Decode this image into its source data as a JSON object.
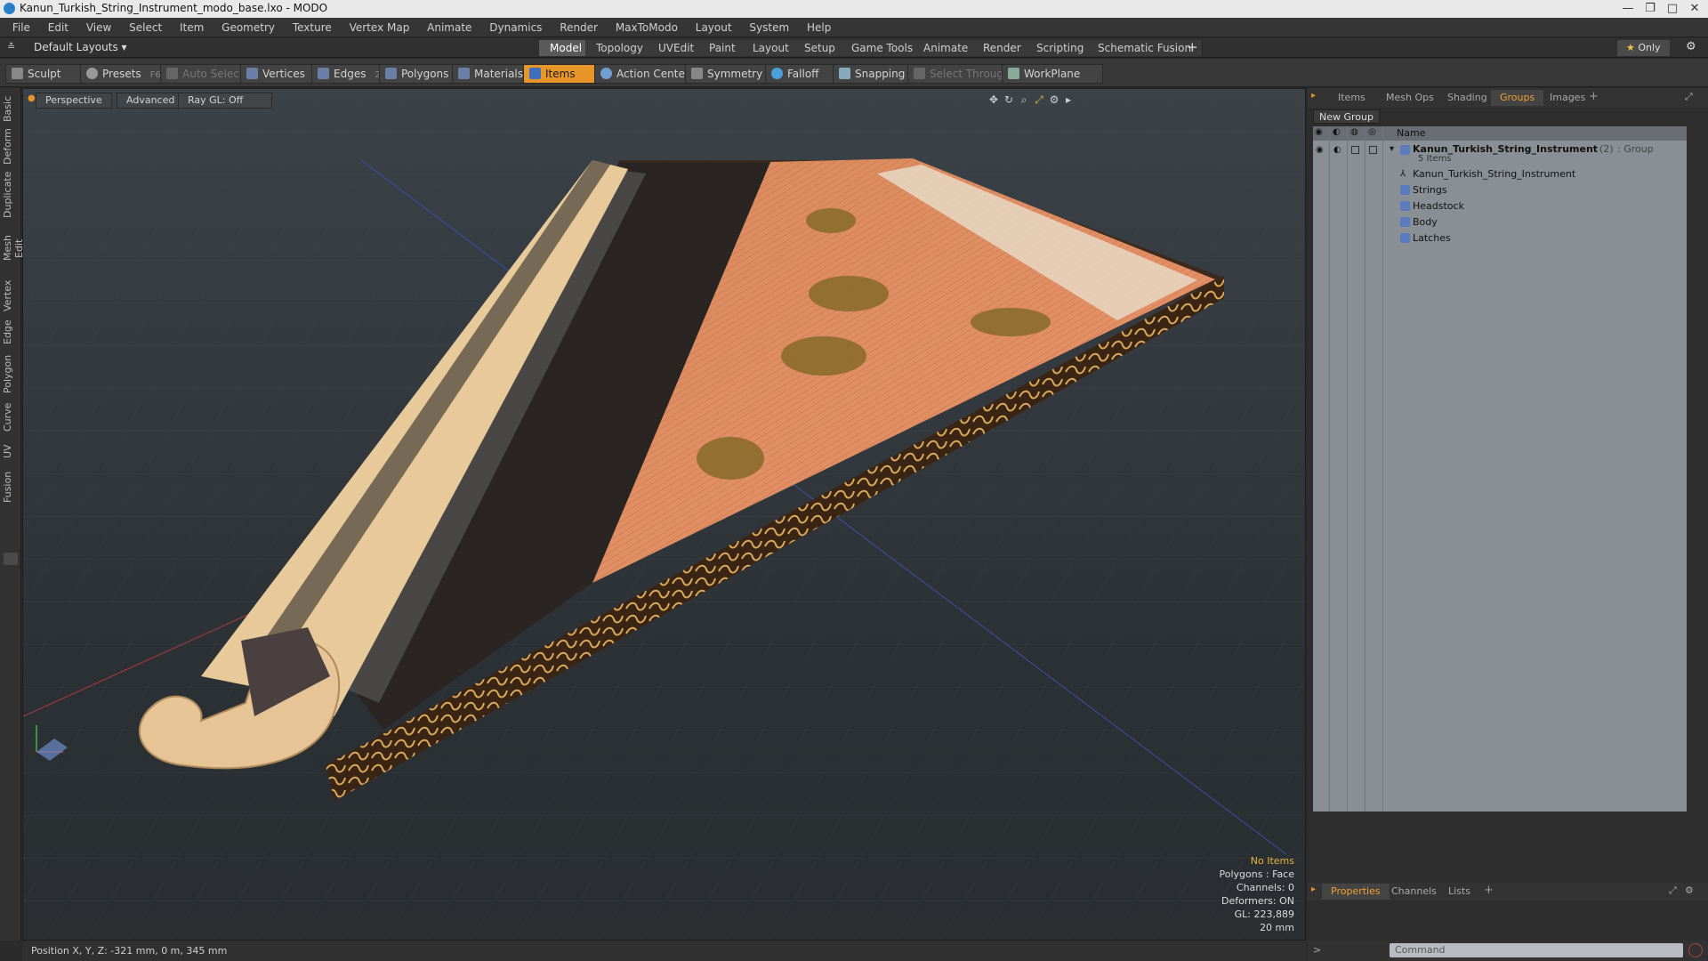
{
  "window": {
    "title": "Kanun_Turkish_String_Instrument_modo_base.lxo - MODO"
  },
  "menu": [
    "File",
    "Edit",
    "View",
    "Select",
    "Item",
    "Geometry",
    "Texture",
    "Vertex Map",
    "Animate",
    "Dynamics",
    "Render",
    "MaxToModo",
    "Layout",
    "System",
    "Help"
  ],
  "layouts": {
    "preset": "Default Layouts",
    "tabs": [
      "Model",
      "Topology",
      "UVEdit",
      "Paint",
      "Layout",
      "Setup",
      "Game Tools",
      "Animate",
      "Render",
      "Scripting",
      "Schematic Fusion"
    ],
    "active": "Model",
    "only_label": "Only"
  },
  "toolbar": {
    "sculpt": "Sculpt",
    "presets": "Presets",
    "presets_key": "F6",
    "auto_select": "Auto Select",
    "vertices": "Vertices",
    "vertices_count": "1",
    "edges": "Edges",
    "edges_count": "2",
    "polygons": "Polygons",
    "materials": "Materials",
    "items": "Items",
    "action_center": "Action Center",
    "symmetry": "Symmetry",
    "falloff": "Falloff",
    "snapping": "Snapping",
    "select_through": "Select Through",
    "workplane": "WorkPlane"
  },
  "left_tabs": [
    "Basic",
    "Deform",
    "Duplicate",
    "Mesh Edit",
    "Vertex",
    "Edge",
    "Polygon",
    "Curve",
    "UV",
    "Fusion"
  ],
  "viewport": {
    "view": "Perspective",
    "shading": "Advanced",
    "raygl": "Ray GL: Off",
    "stats": {
      "items": "No Items",
      "polygons": "Polygons : Face",
      "channels": "Channels: 0",
      "deformers": "Deformers: ON",
      "gl": "GL: 223,889",
      "scale": "20 mm"
    }
  },
  "status": {
    "position": "Position X, Y, Z:  -321 mm, 0 m, 345 mm",
    "command_placeholder": "Command"
  },
  "right_panel": {
    "tabs": [
      "Items",
      "Mesh Ops",
      "Shading",
      "Groups",
      "Images"
    ],
    "active_tab": "Groups",
    "new_group": "New Group",
    "column_name": "Name",
    "group": {
      "name": "Kanun_Turkish_String_Instrument",
      "count": "(2)",
      "type": ": Group",
      "items_count": "5 Items"
    },
    "children": [
      "Kanun_Turkish_String_Instrument",
      "Strings",
      "Headstock",
      "Body",
      "Latches"
    ],
    "bottom_tabs": [
      "Properties",
      "Channels",
      "Lists"
    ],
    "bottom_active": "Properties"
  },
  "colors": {
    "accent": "#e8962a",
    "instrument_top": "#e0895a",
    "instrument_side": "#3a2414",
    "wood": "#e8c99a"
  }
}
